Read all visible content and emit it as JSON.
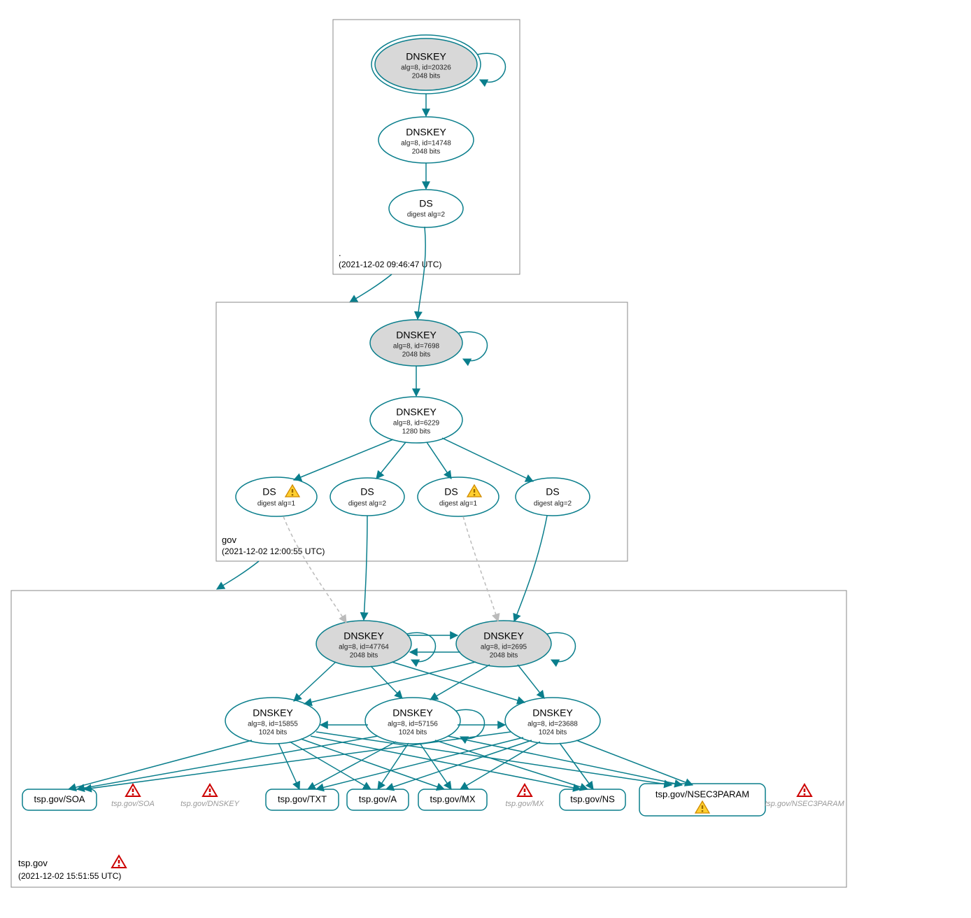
{
  "colors": {
    "stroke": "#0a7e8c",
    "node_grey": "#d8d8d8"
  },
  "zones": {
    "root": {
      "name": ".",
      "timestamp": "(2021-12-02 09:46:47 UTC)"
    },
    "gov": {
      "name": "gov",
      "timestamp": "(2021-12-02 12:00:55 UTC)"
    },
    "tsp": {
      "name": "tsp.gov",
      "timestamp": "(2021-12-02 15:51:55 UTC)"
    }
  },
  "nodes": {
    "root_ksk": {
      "title": "DNSKEY",
      "sub1": "alg=8, id=20326",
      "sub2": "2048 bits"
    },
    "root_zsk": {
      "title": "DNSKEY",
      "sub1": "alg=8, id=14748",
      "sub2": "2048 bits"
    },
    "root_ds": {
      "title": "DS",
      "sub1": "digest alg=2"
    },
    "gov_ksk": {
      "title": "DNSKEY",
      "sub1": "alg=8, id=7698",
      "sub2": "2048 bits"
    },
    "gov_zsk": {
      "title": "DNSKEY",
      "sub1": "alg=8, id=6229",
      "sub2": "1280 bits"
    },
    "gov_ds1": {
      "title": "DS",
      "sub1": "digest alg=1",
      "warn": true
    },
    "gov_ds2": {
      "title": "DS",
      "sub1": "digest alg=2"
    },
    "gov_ds3": {
      "title": "DS",
      "sub1": "digest alg=1",
      "warn": true
    },
    "gov_ds4": {
      "title": "DS",
      "sub1": "digest alg=2"
    },
    "tsp_ksk1": {
      "title": "DNSKEY",
      "sub1": "alg=8, id=47764",
      "sub2": "2048 bits"
    },
    "tsp_ksk2": {
      "title": "DNSKEY",
      "sub1": "alg=8, id=2695",
      "sub2": "2048 bits"
    },
    "tsp_zsk1": {
      "title": "DNSKEY",
      "sub1": "alg=8, id=15855",
      "sub2": "1024 bits"
    },
    "tsp_zsk2": {
      "title": "DNSKEY",
      "sub1": "alg=8, id=57156",
      "sub2": "1024 bits"
    },
    "tsp_zsk3": {
      "title": "DNSKEY",
      "sub1": "alg=8, id=23688",
      "sub2": "1024 bits"
    }
  },
  "rr": {
    "soa": "tsp.gov/SOA",
    "txt": "tsp.gov/TXT",
    "a": "tsp.gov/A",
    "mx": "tsp.gov/MX",
    "ns": "tsp.gov/NS",
    "nsec3": "tsp.gov/NSEC3PARAM"
  },
  "grey_rr": {
    "soa": "tsp.gov/SOA",
    "dnskey": "tsp.gov/DNSKEY",
    "mx": "tsp.gov/MX",
    "nsec3": "tsp.gov/NSEC3PARAM"
  }
}
